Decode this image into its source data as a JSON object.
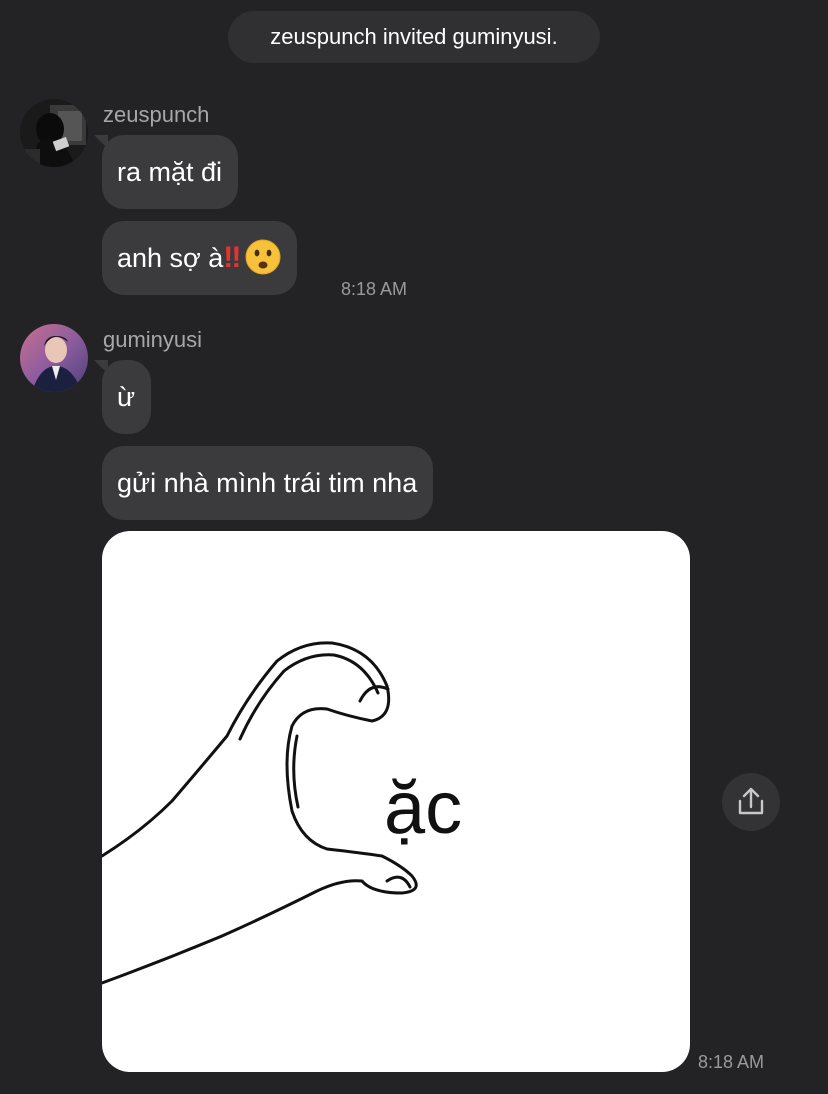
{
  "system_notice": "zeuspunch invited guminyusi.",
  "threads": [
    {
      "sender": "zeuspunch",
      "messages": [
        {
          "text": "ra mặt đi"
        },
        {
          "text": "anh sợ à",
          "emoji_bang": "‼",
          "emoji_face": "frowning-face-emoji"
        }
      ],
      "time": "8:18 AM"
    },
    {
      "sender": "guminyusi",
      "messages": [
        {
          "text": "ừ"
        },
        {
          "text": "gửi nhà mình trái tim nha"
        }
      ],
      "image": {
        "caption": "ặc",
        "depicts": "hand-heart-drawing"
      },
      "time": "8:18 AM"
    }
  ],
  "actions": {
    "share_icon": "share-icon"
  },
  "colors": {
    "background": "#232325",
    "bubble": "#3b3b3e",
    "pill": "#303033",
    "muted_text": "#a7a7ab"
  }
}
